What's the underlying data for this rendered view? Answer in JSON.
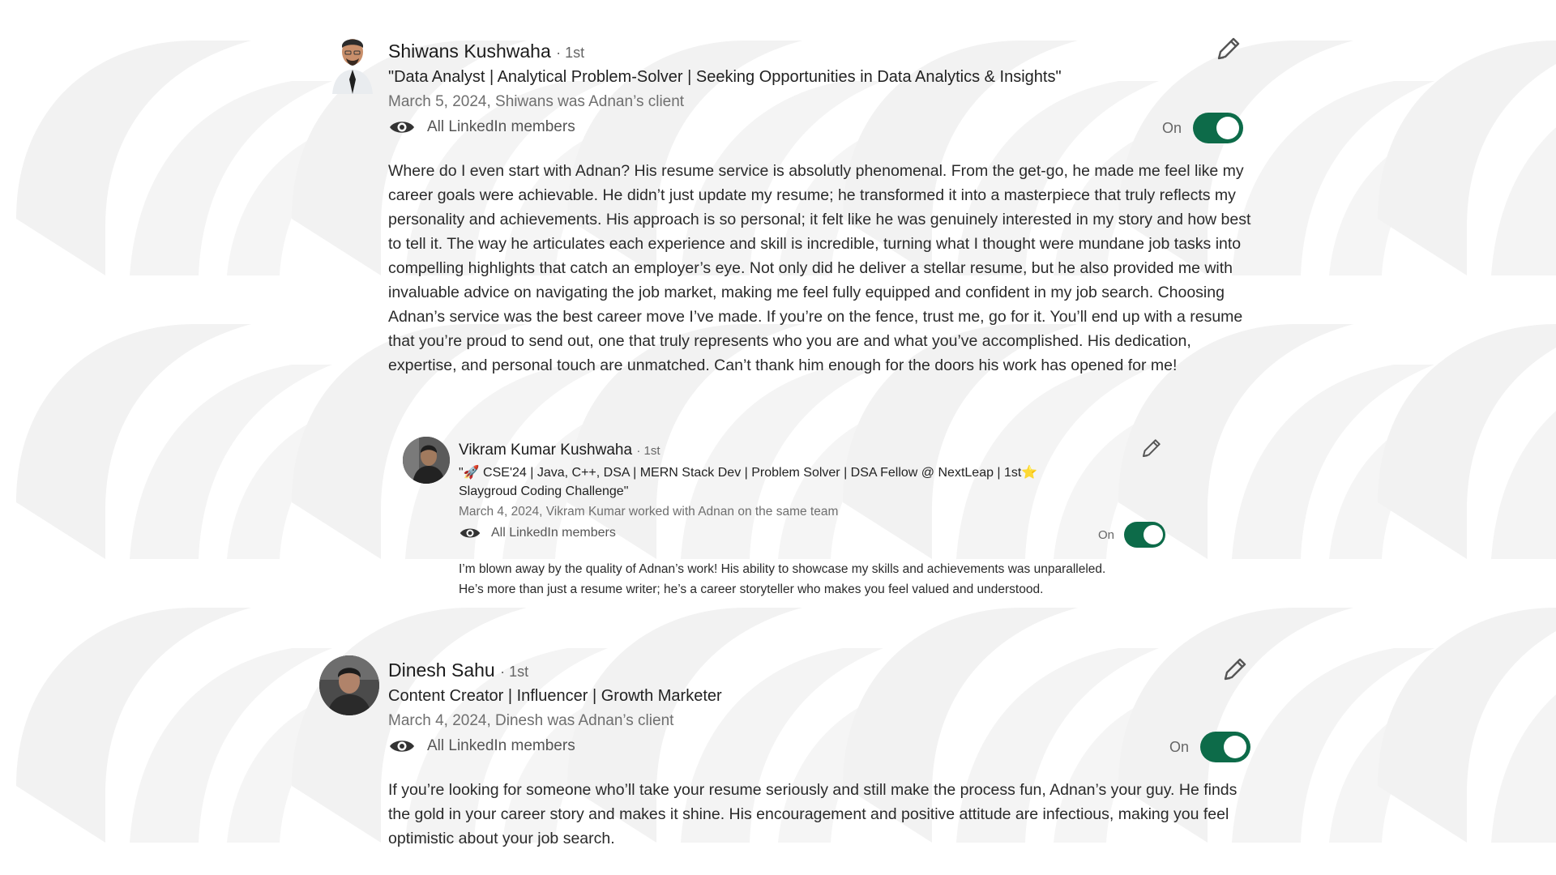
{
  "recommendations": [
    {
      "name": "Shiwans Kushwaha",
      "degree": "· 1st",
      "headline": "\"Data Analyst | Analytical Problem-Solver | Seeking Opportunities in Data Analytics & Insights\"",
      "meta": "March 5, 2024, Shiwans was Adnan’s client",
      "visibility": "All LinkedIn members",
      "toggle_label": "On",
      "toggle_on": true,
      "text": "Where do I even start with Adnan? His resume service is absolutly phenomenal. From the get-go, he made me feel like my career goals were achievable. He didn’t just update my resume; he transformed it into a masterpiece that truly reflects my personality and achievements. His approach is so personal; it felt like he was genuinely interested in my story and how best to tell it. The way he articulates each experience and skill is incredible, turning what I thought were mundane job tasks into compelling highlights that catch an employer’s eye. Not only did he deliver a stellar resume, but he also provided me with invaluable advice on navigating the job market, making me feel fully equipped and confident in my job search. Choosing Adnan’s service was the best career move I’ve made. If you’re on the fence, trust me, go for it. You’ll end up with a resume that you’re proud to send out, one that truly represents who you are and what you’ve accomplished. His dedication, expertise, and personal touch are unmatched. Can’t thank him enough for the doors his work has opened for me!"
    },
    {
      "name": "Vikram Kumar Kushwaha",
      "degree": "· 1st",
      "headline_line1": "\"🚀 CSE'24 | Java, C++, DSA | MERN Stack Dev | Problem Solver | DSA Fellow @ NextLeap | 1st⭐",
      "headline_line2": "Slaygroud Coding Challenge\"",
      "meta": "March 4, 2024, Vikram Kumar worked with Adnan on the same team",
      "visibility": "All LinkedIn members",
      "toggle_label": "On",
      "toggle_on": true,
      "text": "I’m blown away by the quality of Adnan’s work! His ability to showcase my skills and achievements was unparalleled. He’s more than just a resume writer; he’s a career storyteller who makes you feel valued and understood."
    },
    {
      "name": "Dinesh Sahu",
      "degree": "· 1st",
      "headline": "Content Creator | Influencer | Growth Marketer",
      "meta": "March 4, 2024, Dinesh was Adnan’s client",
      "visibility": "All LinkedIn members",
      "toggle_label": "On",
      "toggle_on": true,
      "text": "If you’re looking for someone who’ll take your resume seriously and still make the process fun, Adnan’s your guy. He finds the gold in your career story and makes it shine. His encouragement and positive attitude are infectious, making you feel optimistic about your job search."
    }
  ],
  "colors": {
    "toggle_green": "#0d6b49",
    "background": "#ffffff",
    "watermark": "#f3f3f3"
  },
  "icons": [
    "eye-icon",
    "pencil-edit-icon",
    "avatar-photo"
  ]
}
